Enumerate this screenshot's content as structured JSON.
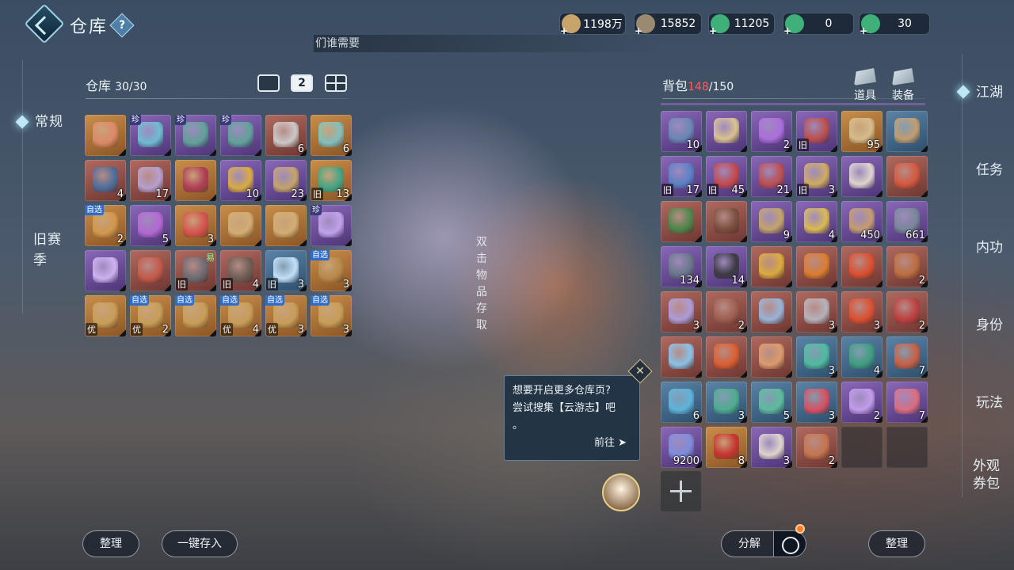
{
  "header": {
    "title": "仓库",
    "help": "?",
    "strip_text": "们谁需要"
  },
  "currencies": [
    {
      "value": "1198万",
      "color": "#c9a46a"
    },
    {
      "value": "15852",
      "color": "#9a8a72"
    },
    {
      "value": "11205",
      "color": "#3fb07a"
    },
    {
      "value": "0",
      "color": "#3fb07a"
    },
    {
      "value": "30",
      "color": "#3fb07a"
    }
  ],
  "left_nav": {
    "items": [
      "常规",
      "旧赛季"
    ],
    "active": "常规"
  },
  "right_nav": {
    "items": [
      "江湖",
      "任务",
      "内功",
      "身份",
      "玩法",
      "外观券包"
    ],
    "active": "江湖"
  },
  "warehouse": {
    "label": "仓库",
    "count": "30/30",
    "pages": [
      "",
      "2",
      ""
    ],
    "items": [
      {
        "r": "orange",
        "c": "#e08a6a",
        "n": "",
        "t": ""
      },
      {
        "r": "purple",
        "c": "#6fc2d6",
        "tl": "珍",
        "n": "",
        "t": ""
      },
      {
        "r": "purple",
        "c": "#5fa79a",
        "tl": "珍",
        "n": "",
        "t": ""
      },
      {
        "r": "purple",
        "c": "#5fa79a",
        "tl": "珍",
        "n": "",
        "t": ""
      },
      {
        "r": "red",
        "c": "#cfcfcf",
        "n": "6",
        "t": ""
      },
      {
        "r": "orange",
        "c": "#7fc4c4",
        "n": "6",
        "t": ""
      },
      {
        "r": "red",
        "c": "#4a6fa0",
        "n": "4",
        "t": ""
      },
      {
        "r": "red",
        "c": "#b9a4d6",
        "n": "17",
        "t": ""
      },
      {
        "r": "orange",
        "c": "#b03a5a",
        "n": "",
        "t": ""
      },
      {
        "r": "purple",
        "c": "#e0b040",
        "n": "10",
        "t": ""
      },
      {
        "r": "purple",
        "c": "#c9a86a",
        "n": "23",
        "t": ""
      },
      {
        "r": "orange",
        "c": "#3aa98a",
        "n": "13",
        "t": "旧"
      },
      {
        "r": "orange",
        "c": "#d49a50",
        "tl": "自选",
        "n": "2",
        "t": ""
      },
      {
        "r": "purple",
        "c": "#b86ad6",
        "n": "5",
        "t": ""
      },
      {
        "r": "orange",
        "c": "#d85050",
        "n": "3",
        "t": ""
      },
      {
        "r": "orange",
        "c": "#d4b076",
        "n": "",
        "t": ""
      },
      {
        "r": "orange",
        "c": "#d4b076",
        "n": "",
        "t": ""
      },
      {
        "r": "purple",
        "c": "#c6a6f0",
        "tl": "珍",
        "n": "",
        "t": ""
      },
      {
        "r": "purple",
        "c": "#d2b8f5",
        "n": "",
        "t": ""
      },
      {
        "r": "red",
        "c": "#c85a4a",
        "n": "",
        "t": ""
      },
      {
        "r": "red",
        "c": "#6a6d74",
        "tr": "易",
        "n": "",
        "t": "旧"
      },
      {
        "r": "red",
        "c": "#6a5f58",
        "n": "4",
        "t": "旧"
      },
      {
        "r": "blue",
        "c": "#c9e6ff",
        "n": "3",
        "t": "旧"
      },
      {
        "r": "orange",
        "c": "#b98a4a",
        "tl": "自选",
        "n": "3",
        "t": ""
      },
      {
        "r": "orange",
        "c": "#caa05a",
        "n": "",
        "t": "优"
      },
      {
        "r": "orange",
        "c": "#caa05a",
        "tl": "自选",
        "n": "2",
        "t": "优"
      },
      {
        "r": "orange",
        "c": "#caa05a",
        "tl": "自选",
        "n": "",
        "t": ""
      },
      {
        "r": "orange",
        "c": "#caa05a",
        "tl": "自选",
        "n": "4",
        "t": "优"
      },
      {
        "r": "orange",
        "c": "#caa05a",
        "tl": "自选",
        "n": "3",
        "t": "优"
      },
      {
        "r": "orange",
        "c": "#caa05a",
        "tl": "自选",
        "n": "3",
        "t": ""
      }
    ]
  },
  "center_hint": [
    "双",
    "击",
    "物",
    "品",
    "存",
    "取"
  ],
  "backpack": {
    "label": "背包",
    "used": "148",
    "total": "/150",
    "tabs": [
      "道具",
      "装备"
    ],
    "items": [
      {
        "r": "purple",
        "c": "#6a8ab6",
        "n": "10",
        "t": ""
      },
      {
        "r": "purple",
        "c": "#e0c890",
        "n": "",
        "t": ""
      },
      {
        "r": "purple",
        "c": "#b070e0",
        "n": "2",
        "t": ""
      },
      {
        "r": "purple",
        "c": "#c0504a",
        "n": "",
        "t": "旧"
      },
      {
        "r": "orange",
        "c": "#d8c090",
        "n": "95",
        "t": ""
      },
      {
        "r": "blue",
        "c": "#c9a070",
        "n": "",
        "t": ""
      },
      {
        "r": "purple",
        "c": "#5a84c8",
        "n": "17",
        "t": "旧"
      },
      {
        "r": "purple",
        "c": "#c84a4a",
        "n": "45",
        "t": "旧"
      },
      {
        "r": "purple",
        "c": "#c05050",
        "n": "21",
        "t": ""
      },
      {
        "r": "purple",
        "c": "#d4b060",
        "n": "3",
        "t": "旧"
      },
      {
        "r": "purple",
        "c": "#e4dcd0",
        "n": "",
        "t": ""
      },
      {
        "r": "red",
        "c": "#d85a40",
        "n": "",
        "t": ""
      },
      {
        "r": "red",
        "c": "#4a8a4a",
        "n": "",
        "t": ""
      },
      {
        "r": "red",
        "c": "#7a5040",
        "n": "",
        "t": ""
      },
      {
        "r": "purple",
        "c": "#c9a86a",
        "n": "9",
        "t": ""
      },
      {
        "r": "purple",
        "c": "#e0c050",
        "n": "4",
        "t": ""
      },
      {
        "r": "purple",
        "c": "#c9a070",
        "n": "450",
        "t": ""
      },
      {
        "r": "purple",
        "c": "#7a8a9a",
        "n": "661",
        "t": ""
      },
      {
        "r": "purple",
        "c": "#6a7a8a",
        "n": "134",
        "t": ""
      },
      {
        "r": "purple",
        "c": "#3a3a40",
        "n": "14",
        "t": ""
      },
      {
        "r": "red",
        "c": "#e0b040",
        "n": "",
        "t": ""
      },
      {
        "r": "red",
        "c": "#e08030",
        "n": "",
        "t": ""
      },
      {
        "r": "red",
        "c": "#e05030",
        "n": "",
        "t": ""
      },
      {
        "r": "red",
        "c": "#c07040",
        "n": "2",
        "t": ""
      },
      {
        "r": "red",
        "c": "#b0a0e0",
        "n": "3",
        "t": ""
      },
      {
        "r": "red",
        "c": "#a06050",
        "n": "2",
        "t": ""
      },
      {
        "r": "red",
        "c": "#9ab8e0",
        "n": "",
        "t": ""
      },
      {
        "r": "red",
        "c": "#b8b8c0",
        "n": "3",
        "t": ""
      },
      {
        "r": "red",
        "c": "#e05030",
        "n": "3",
        "t": ""
      },
      {
        "r": "red",
        "c": "#c04040",
        "n": "2",
        "t": ""
      },
      {
        "r": "red",
        "c": "#8ac8f0",
        "n": "",
        "t": ""
      },
      {
        "r": "red",
        "c": "#e06030",
        "n": "",
        "t": ""
      },
      {
        "r": "red",
        "c": "#e0a070",
        "n": "",
        "t": ""
      },
      {
        "r": "blue",
        "c": "#50c0a0",
        "n": "3",
        "t": ""
      },
      {
        "r": "blue",
        "c": "#40a080",
        "n": "4",
        "t": ""
      },
      {
        "r": "blue",
        "c": "#d06040",
        "n": "7",
        "t": ""
      },
      {
        "r": "blue",
        "c": "#60b8e0",
        "n": "6",
        "t": ""
      },
      {
        "r": "blue",
        "c": "#50b090",
        "n": "3",
        "t": ""
      },
      {
        "r": "blue",
        "c": "#60c0a0",
        "n": "5",
        "t": ""
      },
      {
        "r": "blue",
        "c": "#e05060",
        "n": "3",
        "t": ""
      },
      {
        "r": "purple",
        "c": "#c8a0f0",
        "n": "2",
        "t": ""
      },
      {
        "r": "purple",
        "c": "#e07080",
        "n": "7",
        "t": ""
      },
      {
        "r": "purple",
        "c": "#8090e0",
        "n": "9200",
        "t": ""
      },
      {
        "r": "orange",
        "c": "#c83030",
        "n": "8",
        "t": ""
      },
      {
        "r": "purple",
        "c": "#e4dcd0",
        "n": "3",
        "t": ""
      },
      {
        "r": "red",
        "c": "#c87850",
        "n": "2",
        "t": ""
      },
      {
        "r": "empty",
        "c": "",
        "n": "",
        "t": ""
      },
      {
        "r": "empty",
        "c": "",
        "n": "",
        "t": ""
      }
    ]
  },
  "popup": {
    "text_1": "想要开启更多仓库页?",
    "text_2": "尝试搜集【云游志】吧",
    "text_3": "。",
    "go_label": "前往 ➤",
    "close": "✕"
  },
  "buttons": {
    "sort_left": "整理",
    "deposit_all": "一键存入",
    "decompose": "分解",
    "sort_right": "整理"
  }
}
